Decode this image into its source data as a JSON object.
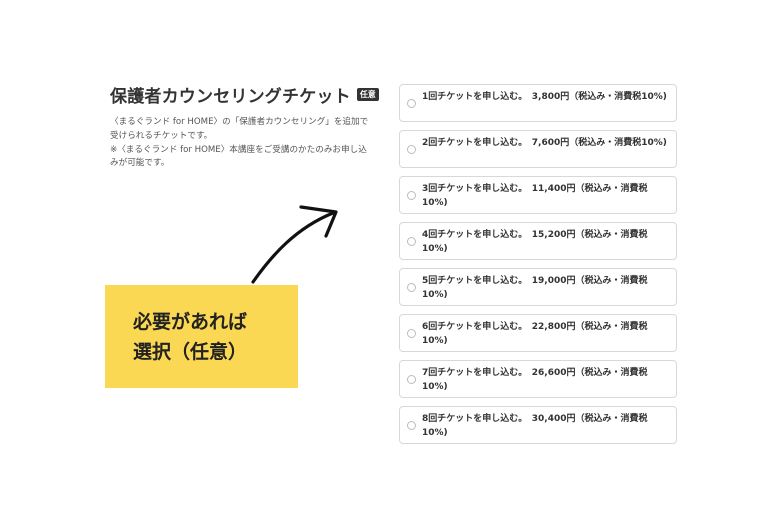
{
  "section": {
    "title": "保護者カウンセリングチケット",
    "badge": "任意",
    "description_lines": [
      "〈まるぐランド for HOME〉の「保護者カウンセリング」を追加で受けられるチケットです。",
      "※〈まるぐランド for HOME〉本講座をご受講のかたのみお申し込みが可能です。"
    ]
  },
  "options": [
    {
      "label": "1回チケットを申し込む。　3,800円（税込み・消費税10%)"
    },
    {
      "label": "2回チケットを申し込む。　7,600円（税込み・消費税10%)"
    },
    {
      "label": "3回チケットを申し込む。　11,400円（税込み・消費税10%)"
    },
    {
      "label": "4回チケットを申し込む。　15,200円（税込み・消費税10%)"
    },
    {
      "label": "5回チケットを申し込む。　19,000円（税込み・消費税10%)"
    },
    {
      "label": "6回チケットを申し込む。　22,800円（税込み・消費税10%)"
    },
    {
      "label": "7回チケットを申し込む。　26,600円（税込み・消費税10%)"
    },
    {
      "label": "8回チケットを申し込む。　30,400円（税込み・消費税10%)"
    }
  ],
  "callout": {
    "text": "必要があれば\n選択（任意）"
  },
  "colors": {
    "callout_bg": "#fbd854",
    "badge_bg": "#333333",
    "option_border": "#d8d8d8"
  },
  "icons": {
    "arrow": "curved-arrow-icon",
    "radio": "radio-unchecked-icon"
  }
}
